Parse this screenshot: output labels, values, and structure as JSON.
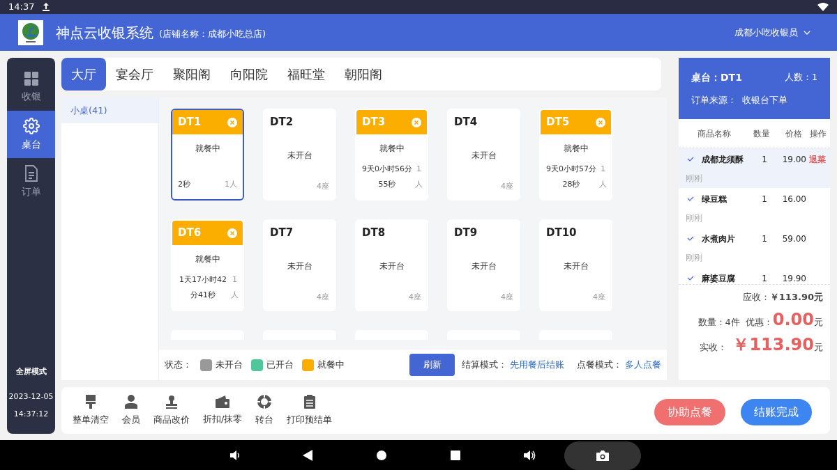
{
  "status_bar": {
    "time": "14:37"
  },
  "header": {
    "title": "神点云收银系统",
    "store": "(店铺名称：成都小吃总店)",
    "user": "成都小吃收银员"
  },
  "nav": [
    {
      "label": "收银",
      "kind": "grid",
      "selected": false
    },
    {
      "label": "桌台",
      "kind": "gear",
      "selected": true
    },
    {
      "label": "订单",
      "kind": "doc",
      "selected": false
    }
  ],
  "nav_footer": {
    "fullscreen": "全屏模式",
    "date": "2023-12-05",
    "time": "14:37:12"
  },
  "areas": [
    {
      "label": "大厅",
      "selected": true
    },
    {
      "label": "宴会厅",
      "selected": false
    },
    {
      "label": "聚阳阁",
      "selected": false
    },
    {
      "label": "向阳院",
      "selected": false
    },
    {
      "label": "福旺堂",
      "selected": false
    },
    {
      "label": "朝阳阁",
      "selected": false
    }
  ],
  "groups": [
    {
      "label": "小桌(41)",
      "selected": true
    }
  ],
  "tables": [
    {
      "name": "DT1",
      "kind": "dining",
      "selected": true,
      "state": "就餐中",
      "duration": "2秒",
      "people": "1人"
    },
    {
      "name": "DT2",
      "kind": "free",
      "selected": false,
      "state": "未开台",
      "seats": "4座"
    },
    {
      "name": "DT3",
      "kind": "dining",
      "selected": false,
      "state": "就餐中",
      "duration": "9天0小时56分55秒",
      "people": "1人"
    },
    {
      "name": "DT4",
      "kind": "free",
      "selected": false,
      "state": "未开台",
      "seats": "4座"
    },
    {
      "name": "DT5",
      "kind": "dining",
      "selected": false,
      "state": "就餐中",
      "duration": "9天0小时57分28秒",
      "people": "1人"
    },
    {
      "name": "DT6",
      "kind": "dining",
      "selected": false,
      "state": "就餐中",
      "duration": "1天17小时42分41秒",
      "people": "1人"
    },
    {
      "name": "DT7",
      "kind": "free",
      "selected": false,
      "state": "未开台",
      "seats": "4座"
    },
    {
      "name": "DT8",
      "kind": "free",
      "selected": false,
      "state": "未开台",
      "seats": "4座"
    },
    {
      "name": "DT9",
      "kind": "free",
      "selected": false,
      "state": "未开台",
      "seats": "4座"
    },
    {
      "name": "DT10",
      "kind": "free",
      "selected": false,
      "state": "未开台",
      "seats": "4座"
    },
    {
      "kind": "partial"
    },
    {
      "kind": "partial"
    },
    {
      "kind": "partial"
    },
    {
      "kind": "partial"
    },
    {
      "kind": "partial"
    }
  ],
  "legend": {
    "label": "状态：",
    "items": [
      {
        "label": "未开台",
        "color": "#999999"
      },
      {
        "label": "已开台",
        "color": "#4fc79a"
      },
      {
        "label": "就餐中",
        "color": "#fbae00"
      }
    ]
  },
  "refresh_button": "刷新",
  "settle_mode": {
    "label": "结算模式：",
    "value": "先用餐后结账"
  },
  "order_mode": {
    "label": "点餐模式：",
    "value": "多人点餐"
  },
  "order": {
    "table": "桌台：DT1",
    "people": "人数：1",
    "source": "订单来源：  收银台下单",
    "columns": [
      "商品名称",
      "数量",
      "价格",
      "操作"
    ],
    "items": [
      {
        "name": "成都龙须酥",
        "qty": "1",
        "price": "19.00",
        "action": "退菜",
        "time": "刚刚",
        "selected": true
      },
      {
        "name": "绿豆糕",
        "qty": "1",
        "price": "16.00",
        "time": "刚刚",
        "selected": false
      },
      {
        "name": "水煮肉片",
        "qty": "1",
        "price": "59.00",
        "time": "刚刚",
        "selected": false
      },
      {
        "name": "麻婆豆腐",
        "qty": "1",
        "price": "19.90",
        "selected": false
      }
    ],
    "receivable_label": "应收：",
    "receivable": "￥113.90元",
    "count": "数量：4件",
    "discount_label": "优惠：",
    "discount": "0.00",
    "discount_unit": "元",
    "paid_label": "实收：",
    "paid": "￥113.90",
    "paid_unit": "元"
  },
  "actions": [
    {
      "label": "整单清空",
      "kind": "brush"
    },
    {
      "label": "会员",
      "kind": "person"
    },
    {
      "label": "商品改价",
      "kind": "stamp"
    },
    {
      "label": "折扣/抹零",
      "kind": "wallet"
    },
    {
      "label": "转台",
      "kind": "ring"
    },
    {
      "label": "打印预结单",
      "kind": "clipboard"
    }
  ],
  "assist_button": "协助点餐",
  "checkout_button": "结账完成"
}
